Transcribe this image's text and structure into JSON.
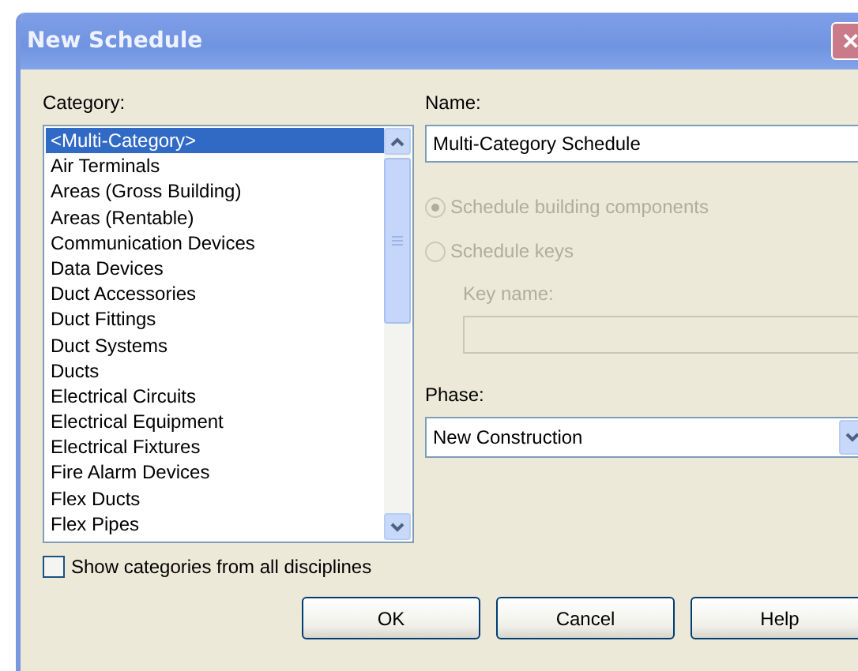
{
  "window": {
    "title": "New Schedule",
    "close": "✕"
  },
  "category": {
    "label": "Category:",
    "items": [
      {
        "label": "<Multi-Category>",
        "selected": true
      },
      {
        "label": "Air Terminals",
        "selected": false
      },
      {
        "label": "Areas (Gross Building)",
        "selected": false
      },
      {
        "label": "Areas (Rentable)",
        "selected": false
      },
      {
        "label": "Communication Devices",
        "selected": false
      },
      {
        "label": "Data Devices",
        "selected": false
      },
      {
        "label": "Duct Accessories",
        "selected": false
      },
      {
        "label": "Duct Fittings",
        "selected": false
      },
      {
        "label": "Duct Systems",
        "selected": false
      },
      {
        "label": "Ducts",
        "selected": false
      },
      {
        "label": "Electrical Circuits",
        "selected": false
      },
      {
        "label": "Electrical Equipment",
        "selected": false
      },
      {
        "label": "Electrical Fixtures",
        "selected": false
      },
      {
        "label": "Fire Alarm Devices",
        "selected": false
      },
      {
        "label": "Flex Ducts",
        "selected": false
      },
      {
        "label": "Flex Pipes",
        "selected": false
      }
    ]
  },
  "show_all": {
    "label": "Show categories from all disciplines",
    "checked": false
  },
  "name": {
    "label": "Name:",
    "value": "Multi-Category Schedule"
  },
  "schedule_type": [
    {
      "label": "Schedule building components",
      "selected": true,
      "disabled": true
    },
    {
      "label": "Schedule keys",
      "selected": false,
      "disabled": true
    }
  ],
  "key_name": {
    "label": "Key name:",
    "disabled": true
  },
  "phase": {
    "label": "Phase:",
    "value": "New Construction"
  },
  "buttons": [
    "OK",
    "Cancel",
    "Help"
  ]
}
